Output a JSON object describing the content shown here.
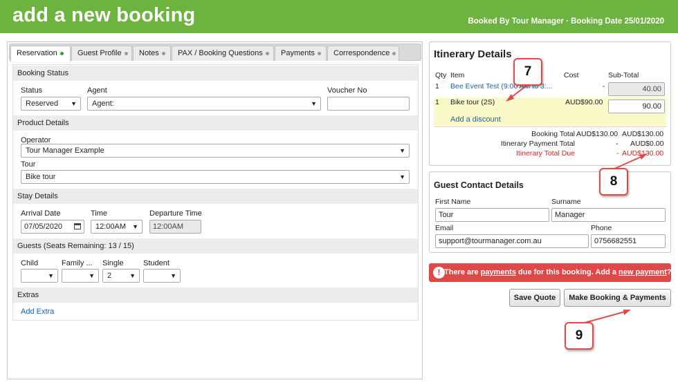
{
  "header": {
    "title": "add a new booking",
    "meta": "Booked By Tour Manager · Booking Date 25/01/2020"
  },
  "tabs": [
    {
      "label": "Reservation"
    },
    {
      "label": "Guest Profile"
    },
    {
      "label": "Notes"
    },
    {
      "label": "PAX / Booking Questions"
    },
    {
      "label": "Payments"
    },
    {
      "label": "Correspondence"
    }
  ],
  "booking_status": {
    "section": "Booking Status",
    "status_label": "Status",
    "status_value": "Reserved",
    "agent_label": "Agent",
    "agent_value": "Agent:",
    "voucher_label": "Voucher No",
    "voucher_value": ""
  },
  "product": {
    "section": "Product Details",
    "operator_label": "Operator",
    "operator_value": "Tour Manager Example",
    "tour_label": "Tour",
    "tour_value": "Bike tour"
  },
  "stay": {
    "section": "Stay Details",
    "arrival_label": "Arrival Date",
    "arrival_value": "07/05/2020",
    "time_label": "Time",
    "time_value": "12:00AM",
    "departure_label": "Departure Time",
    "departure_value": "12:00AM"
  },
  "guests": {
    "section": "Guests (Seats Remaining: 13 / 15)",
    "child_label": "Child",
    "child_value": "",
    "family_label": "Family ...",
    "family_value": "",
    "single_label": "Single",
    "single_value": "2",
    "student_label": "Student",
    "student_value": ""
  },
  "extras": {
    "section": "Extras",
    "add_link": "Add Extra"
  },
  "itinerary": {
    "title": "Itinerary Details",
    "cols": {
      "qty": "Qty",
      "item": "Item",
      "cost": "Cost",
      "subtotal": "Sub-Total"
    },
    "rows": [
      {
        "qty": "1",
        "item": "Bee Event Test (9:00 AM to 3:...",
        "cost": "-",
        "subtotal": "40.00"
      },
      {
        "qty": "1",
        "item": "Bike tour (2S)",
        "cost": "AUD$90.00",
        "subtotal": "90.00"
      }
    ],
    "add_discount": "Add a discount",
    "booking_total_label": "Booking Total",
    "booking_total_a": "AUD$130.00",
    "booking_total_b": "AUD$130.00",
    "payment_total_label": "Itinerary Payment Total",
    "payment_total_a": "-",
    "payment_total_b": "AUD$0.00",
    "due_label": "Itinerary Total Due",
    "due_a": "-",
    "due_b": "AUD$130.00"
  },
  "guest_contact": {
    "title": "Guest Contact Details",
    "first_label": "First Name",
    "first_value": "Tour",
    "surname_label": "Surname",
    "surname_value": "Manager",
    "email_label": "Email",
    "email_value": "support@tourmanager.com.au",
    "phone_label": "Phone",
    "phone_value": "0756682551"
  },
  "alert": {
    "icon": "!",
    "part1": "There are ",
    "link1": "payments",
    "part2": " due for this booking. Add a ",
    "link2": "new payment",
    "part3": "?"
  },
  "buttons": {
    "save_quote": "Save Quote",
    "make_booking": "Make Booking & Payments"
  },
  "callouts": {
    "c7": "7",
    "c8": "8",
    "c9": "9"
  },
  "colors": {
    "header_green": "#6db33f",
    "alert_red": "#e04848",
    "link_blue": "#1a5fb4",
    "due_red": "#e02020",
    "callout_border": "#e24a4a"
  }
}
